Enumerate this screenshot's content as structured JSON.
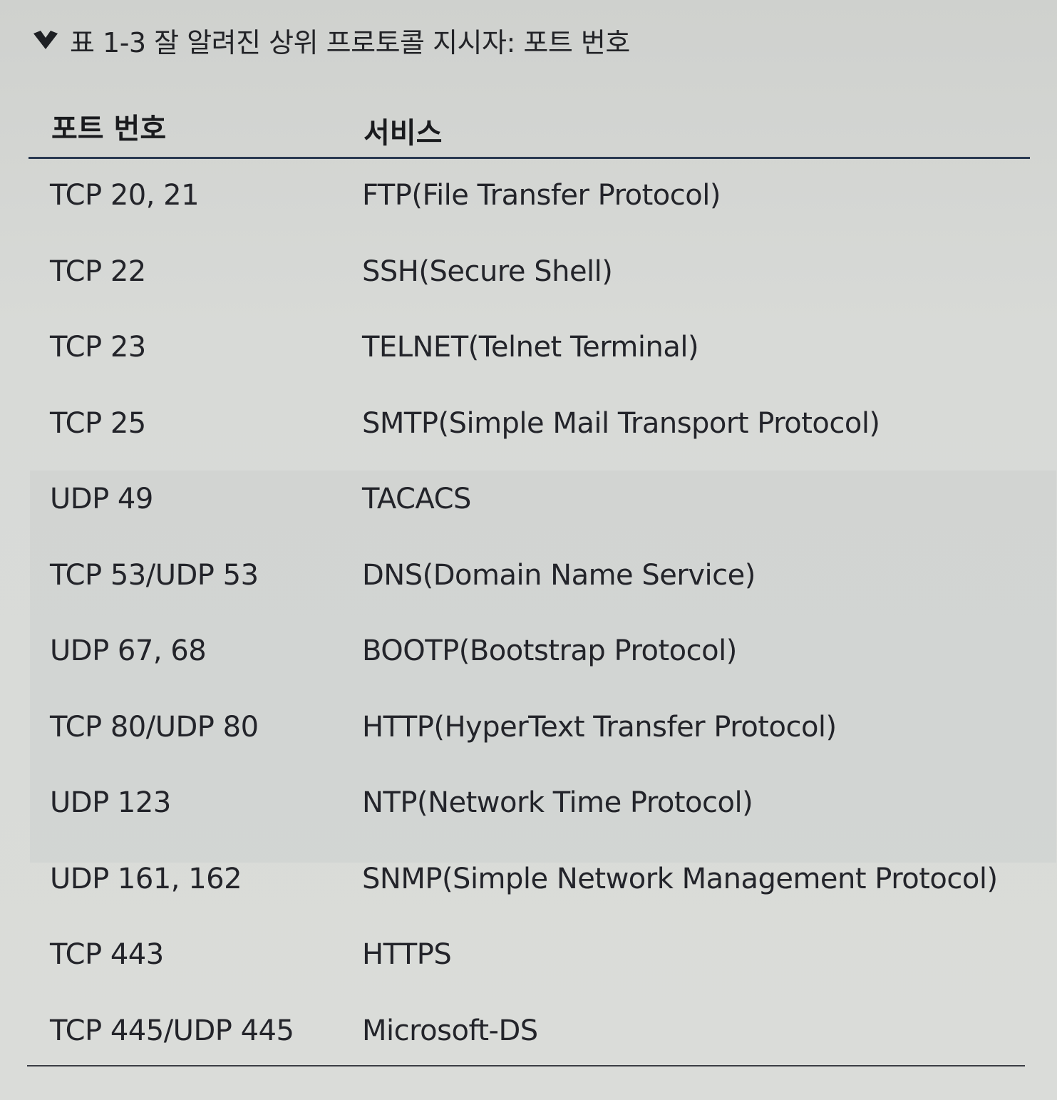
{
  "caption": {
    "icon": "chevron-down-icon",
    "text": "표 1-3 잘 알려진 상위 프로토콜 지시자: 포트 번호"
  },
  "table": {
    "headers": {
      "port": "포트 번호",
      "service": "서비스"
    },
    "rows": [
      {
        "port": "TCP 20, 21",
        "service": "FTP(File Transfer Protocol)"
      },
      {
        "port": "TCP 22",
        "service": "SSH(Secure Shell)"
      },
      {
        "port": "TCP 23",
        "service": "TELNET(Telnet Terminal)"
      },
      {
        "port": "TCP 25",
        "service": "SMTP(Simple Mail Transport Protocol)"
      },
      {
        "port": "UDP 49",
        "service": "TACACS"
      },
      {
        "port": "TCP 53/UDP 53",
        "service": "DNS(Domain Name Service)"
      },
      {
        "port": "UDP 67, 68",
        "service": "BOOTP(Bootstrap Protocol)"
      },
      {
        "port": "TCP 80/UDP 80",
        "service": "HTTP(HyperText Transfer Protocol)"
      },
      {
        "port": "UDP 123",
        "service": "NTP(Network Time Protocol)"
      },
      {
        "port": "UDP 161, 162",
        "service": "SNMP(Simple Network Management Protocol)"
      },
      {
        "port": "TCP 443",
        "service": "HTTPS"
      },
      {
        "port": "TCP 445/UDP 445",
        "service": "Microsoft-DS"
      }
    ]
  }
}
